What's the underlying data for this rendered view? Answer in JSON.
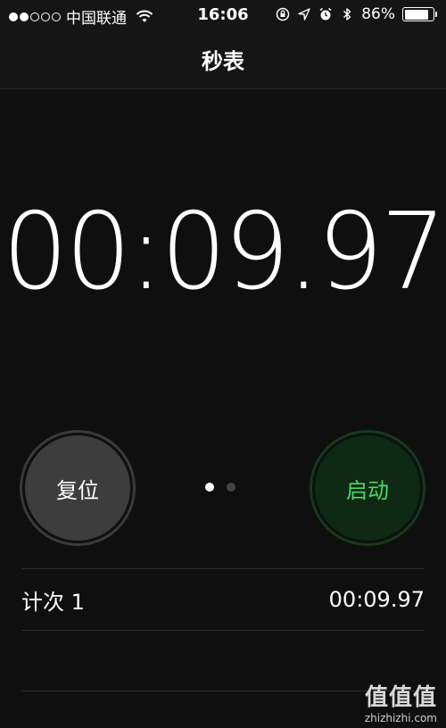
{
  "status": {
    "carrier": "中国联通",
    "time": "16:06",
    "battery": "86%",
    "battery_level": 0.86,
    "signal_filled": 2,
    "signal_total": 5
  },
  "nav": {
    "title": "秒表"
  },
  "timer": {
    "display": "00:09.97"
  },
  "controls": {
    "reset_label": "复位",
    "start_label": "启动",
    "start_color": "#4cd964",
    "page_dots": 2,
    "active_page": 0
  },
  "laps": [
    {
      "label": "计次 1",
      "time": "00:09.97"
    }
  ],
  "watermark": {
    "logo": "值值值",
    "url": "zhizhizhi.com"
  }
}
